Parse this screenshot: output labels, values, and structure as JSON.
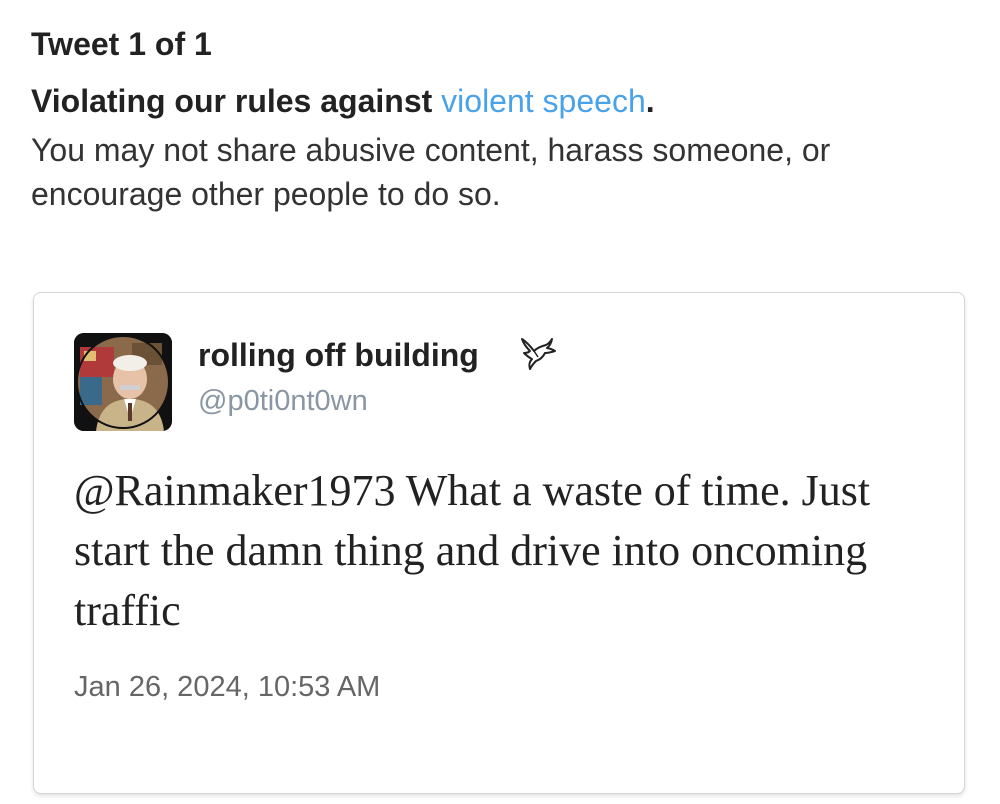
{
  "header": {
    "counter": "Tweet 1 of 1",
    "violation_prefix": "Violating our rules against ",
    "violation_link": "violent speech",
    "violation_suffix": ".",
    "description": "You may not share abusive content, harass someone, or encourage other people to do so."
  },
  "tweet": {
    "avatar_icon": "user-avatar-photo",
    "display_name": "rolling off building",
    "badge_icon": "dove-icon",
    "handle": "@p0ti0nt0wn",
    "mention": "@Rainmaker1973",
    "body": " What a waste of time. Just start the damn thing and drive into oncoming traffic",
    "timestamp": "Jan 26, 2024, 10:53 AM"
  },
  "colors": {
    "link": "#4aa3e8",
    "handle": "#8a96a3",
    "timestamp": "#666666",
    "text": "#222222",
    "card_border": "#d6d6d6"
  }
}
